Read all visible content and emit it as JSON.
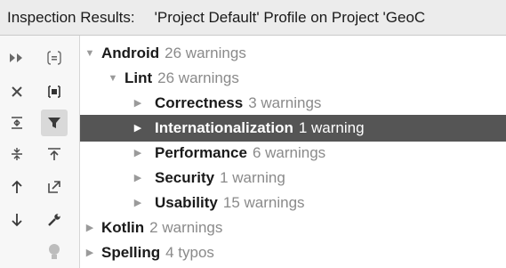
{
  "header": {
    "title": "Inspection Results:",
    "profile": "'Project Default' Profile on Project 'GeoC"
  },
  "toolbar": {
    "buttons": [
      {
        "name": "expand-all-icon",
        "active": false
      },
      {
        "name": "group-by-severity-icon",
        "active": false
      },
      {
        "name": "close-icon",
        "active": false
      },
      {
        "name": "group-by-directory-icon",
        "active": false
      },
      {
        "name": "expand-tree-icon",
        "active": false
      },
      {
        "name": "filter-icon",
        "active": true
      },
      {
        "name": "collapse-tree-icon",
        "active": false
      },
      {
        "name": "autoscroll-to-source-icon",
        "active": false
      },
      {
        "name": "previous-problem-icon",
        "active": false
      },
      {
        "name": "export-icon",
        "active": false
      },
      {
        "name": "next-problem-icon",
        "active": false
      },
      {
        "name": "edit-settings-icon",
        "active": false
      },
      {
        "name": "quick-fix-icon",
        "active": false
      }
    ]
  },
  "tree": {
    "rows": [
      {
        "name": "Android",
        "count": "26 warnings",
        "expanded": true,
        "selected": false
      },
      {
        "name": "Lint",
        "count": "26 warnings",
        "expanded": true,
        "selected": false
      },
      {
        "name": "Correctness",
        "count": "3 warnings",
        "expanded": false,
        "selected": false
      },
      {
        "name": "Internationalization",
        "count": "1 warning",
        "expanded": false,
        "selected": true
      },
      {
        "name": "Performance",
        "count": "6 warnings",
        "expanded": false,
        "selected": false
      },
      {
        "name": "Security",
        "count": "1 warning",
        "expanded": false,
        "selected": false
      },
      {
        "name": "Usability",
        "count": "15 warnings",
        "expanded": false,
        "selected": false
      },
      {
        "name": "Kotlin",
        "count": "2 warnings",
        "expanded": false,
        "selected": false
      },
      {
        "name": "Spelling",
        "count": "4 typos",
        "expanded": false,
        "selected": false
      }
    ]
  }
}
